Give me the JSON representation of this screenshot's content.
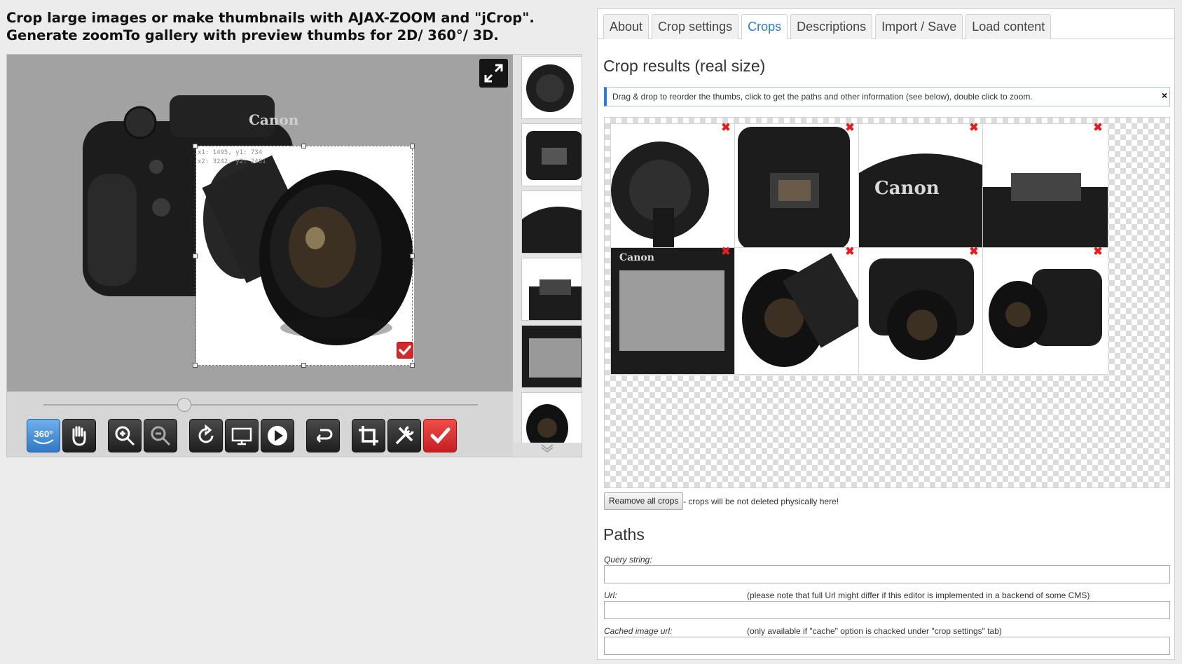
{
  "page": {
    "title_line1": "Crop large images or make thumbnails with AJAX-ZOOM and \"jCrop\".",
    "title_line2": "Generate zoomTo gallery with preview thumbs for 2D/ 360°/ 3D."
  },
  "viewer": {
    "crop_coords_line1": "x1: 1495, y1: 734",
    "crop_coords_line2": "x2: 3242, y2: 2481",
    "brand_text": "Canon",
    "toolbar": {
      "buttons": [
        {
          "name": "spin-360-button",
          "label": "360°",
          "icon": "360-icon"
        },
        {
          "name": "pan-button",
          "icon": "hand-icon"
        },
        {
          "name": "zoom-in-button",
          "icon": "zoom-in-icon"
        },
        {
          "name": "zoom-out-button",
          "icon": "zoom-out-icon"
        },
        {
          "name": "rotate-button",
          "icon": "rotate-icon"
        },
        {
          "name": "screen-button",
          "icon": "monitor-icon"
        },
        {
          "name": "play-button",
          "icon": "play-icon"
        },
        {
          "name": "undo-button",
          "icon": "undo-icon"
        },
        {
          "name": "crop-button",
          "icon": "crop-icon"
        },
        {
          "name": "settings-button",
          "icon": "tools-icon"
        },
        {
          "name": "confirm-button",
          "icon": "check-icon"
        }
      ]
    },
    "thumb_count": 6
  },
  "tabs": [
    {
      "label": "About",
      "active": false
    },
    {
      "label": "Crop settings",
      "active": false
    },
    {
      "label": "Crops",
      "active": true
    },
    {
      "label": "Descriptions",
      "active": false
    },
    {
      "label": "Import / Save",
      "active": false
    },
    {
      "label": "Load content",
      "active": false
    }
  ],
  "crops_section": {
    "heading": "Crop results (real size)",
    "info_text": "Drag & drop to reorder the thumbs, click to get the paths and other information (see below), double click to zoom.",
    "info_close": "×",
    "crop_count": 8,
    "remove_all_label": "Reamove all crops",
    "remove_note": "- crops will be not deleted physically here!"
  },
  "paths_section": {
    "heading": "Paths",
    "query_label": "Query string:",
    "query_value": "",
    "url_label": "Url:",
    "url_note": "(please note that full Url might differ if this editor is implemented in a backend of some CMS)",
    "url_value": "",
    "cached_label": "Cached image url:",
    "cached_note": "(only available if \"cache\" option is chacked under \"crop settings\" tab)",
    "cached_value": ""
  },
  "colors": {
    "accent": "#2a7bd1",
    "delete_red": "#e02020",
    "confirm_red": "#d02a2a",
    "spin_blue": "#3d8ad8"
  }
}
